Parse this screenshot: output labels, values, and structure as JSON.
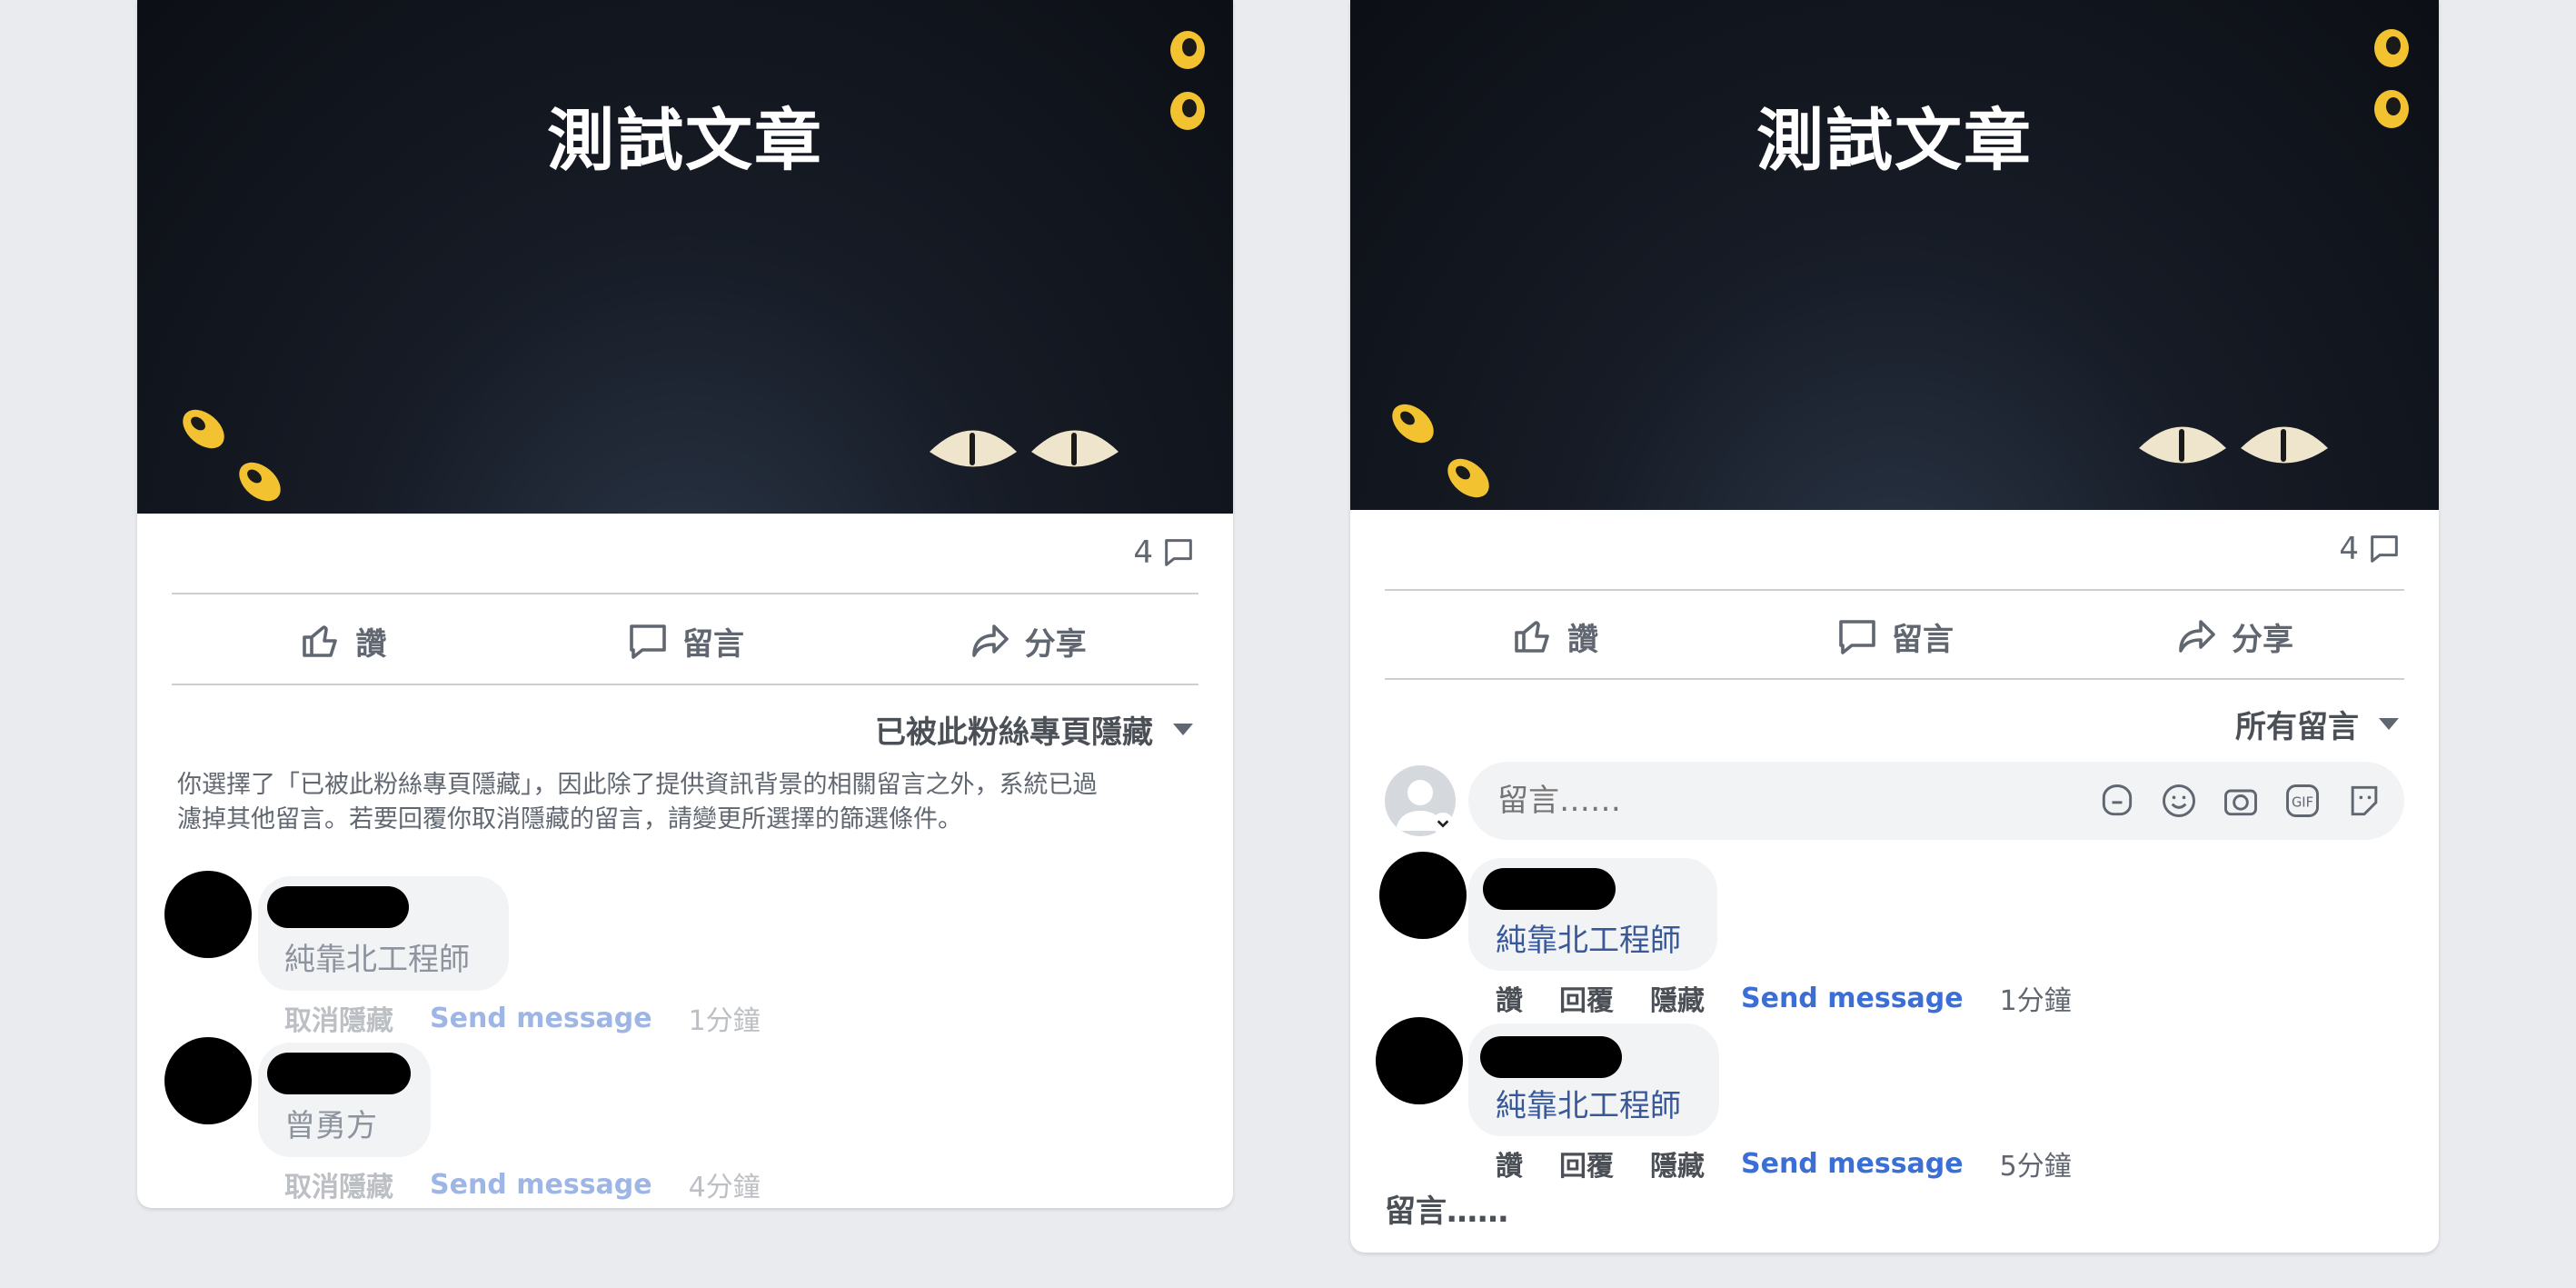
{
  "left_post": {
    "banner_title": "測試文章",
    "comment_count": "4",
    "actions": {
      "like": "讚",
      "comment": "留言",
      "share": "分享"
    },
    "filter_label": "已被此粉絲專頁隱藏",
    "notice_line1": "你選擇了「已被此粉絲專頁隱藏」，因此除了提供資訊背景的相關留言之外，系統已過",
    "notice_line2": "濾掉其他留言。若要回覆你取消隱藏的留言，請變更所選擇的篩選條件。",
    "comments": [
      {
        "text": "純靠北工程師",
        "unhide": "取消隱藏",
        "send_message": "Send message",
        "time": "1分鐘"
      },
      {
        "text": "曾勇方",
        "unhide": "取消隱藏",
        "send_message": "Send message",
        "time": "4分鐘"
      }
    ]
  },
  "right_post": {
    "banner_title": "測試文章",
    "comment_count": "4",
    "actions": {
      "like": "讚",
      "comment": "留言",
      "share": "分享"
    },
    "filter_label": "所有留言",
    "composer_placeholder": "留言……",
    "comments": [
      {
        "text": "純靠北工程師",
        "like": "讚",
        "reply": "回覆",
        "hide": "隱藏",
        "send_message": "Send message",
        "time": "1分鐘"
      },
      {
        "text": "純靠北工程師",
        "like": "讚",
        "reply": "回覆",
        "hide": "隱藏",
        "send_message": "Send message",
        "time": "5分鐘"
      }
    ],
    "footer_comment": "留言……"
  },
  "colors": {
    "page_bg": "#e9ebee",
    "link_blue": "#3b6fd6",
    "muted_gray": "#bcc0c4",
    "cat_eye_yellow": "#f2c230",
    "cat_eye_cream": "#efe4cc"
  },
  "icons": [
    "like-icon",
    "comment-icon",
    "share-icon",
    "caret-down-icon",
    "sticker-icon",
    "emoji-icon",
    "camera-icon",
    "gif-icon",
    "sticker-face-icon"
  ]
}
